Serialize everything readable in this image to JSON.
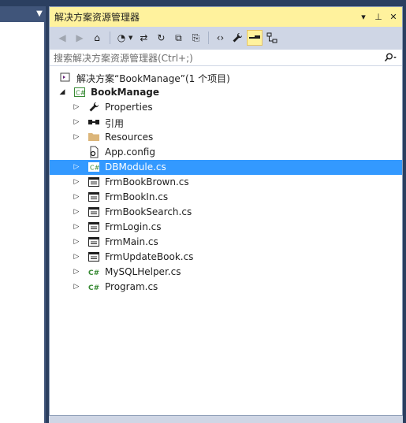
{
  "panel": {
    "title": "解决方案资源管理器",
    "title_buttons": [
      "▾",
      "⊥",
      "✕"
    ]
  },
  "search": {
    "placeholder": "搜索解决方案资源管理器(Ctrl+;)"
  },
  "toolbar": {
    "tools": [
      {
        "name": "back-icon",
        "glyph": "◀"
      },
      {
        "name": "forward-icon",
        "glyph": "▶"
      },
      {
        "name": "home-icon",
        "glyph": "⌂"
      },
      {
        "name": "pending-changes-icon",
        "glyph": "◔"
      },
      {
        "name": "sync-icon",
        "glyph": "⇄"
      },
      {
        "name": "refresh-icon",
        "glyph": "↻"
      },
      {
        "name": "collapse-all-icon",
        "glyph": "⧉"
      },
      {
        "name": "show-all-files-icon",
        "glyph": "⎘"
      },
      {
        "name": "view-code-icon",
        "glyph": "‹›"
      },
      {
        "name": "properties-icon",
        "glyph": "🔧"
      },
      {
        "name": "preview-selected-icon",
        "glyph": "▬"
      },
      {
        "name": "class-diagram-icon",
        "glyph": "⊞"
      }
    ]
  },
  "tree": {
    "solution": "解决方案“BookManage”(1 个项目)",
    "project": "BookManage",
    "items": [
      {
        "label": "Properties",
        "icon": "wrench-icon",
        "expandable": true
      },
      {
        "label": "引用",
        "icon": "references-icon",
        "expandable": true
      },
      {
        "label": "Resources",
        "icon": "folder-icon",
        "expandable": true
      },
      {
        "label": "App.config",
        "icon": "config-file-icon",
        "expandable": false
      },
      {
        "label": "DBModule.cs",
        "icon": "csharp-module-icon",
        "expandable": true,
        "selected": true
      },
      {
        "label": "FrmBookBrown.cs",
        "icon": "form-icon",
        "expandable": true
      },
      {
        "label": "FrmBookIn.cs",
        "icon": "form-icon",
        "expandable": true
      },
      {
        "label": "FrmBookSearch.cs",
        "icon": "form-icon",
        "expandable": true
      },
      {
        "label": "FrmLogin.cs",
        "icon": "form-icon",
        "expandable": true
      },
      {
        "label": "FrmMain.cs",
        "icon": "form-icon",
        "expandable": true
      },
      {
        "label": "FrmUpdateBook.cs",
        "icon": "form-icon",
        "expandable": true
      },
      {
        "label": "MySQLHelper.cs",
        "icon": "csharp-file-icon",
        "expandable": true
      },
      {
        "label": "Program.cs",
        "icon": "csharp-file-icon",
        "expandable": true
      }
    ]
  },
  "colors": {
    "title_bg": "#fff29d",
    "toolbar_bg": "#cfd6e5",
    "selection": "#3399ff",
    "frame": "#2b3f60"
  }
}
